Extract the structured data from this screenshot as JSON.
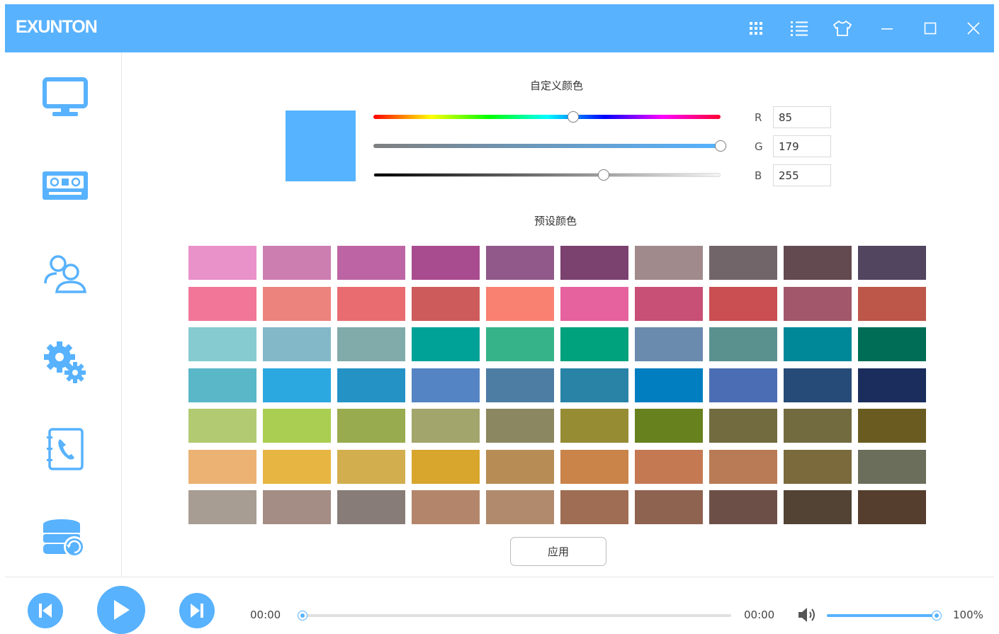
{
  "app": {
    "logo": "EXUNTON"
  },
  "titlebar": {
    "buttons": [
      {
        "name": "grid-icon"
      },
      {
        "name": "list-icon"
      },
      {
        "name": "skin-icon"
      },
      {
        "name": "minimize-icon"
      },
      {
        "name": "maximize-icon"
      },
      {
        "name": "close-icon"
      }
    ]
  },
  "sidebar": {
    "items": [
      {
        "name": "monitor-icon"
      },
      {
        "name": "cassette-icon"
      },
      {
        "name": "users-icon"
      },
      {
        "name": "gears-icon"
      },
      {
        "name": "phonebook-icon"
      },
      {
        "name": "database-sync-icon"
      }
    ]
  },
  "custom_color": {
    "title": "自定义颜色",
    "preview_color": "#55b3ff",
    "hue_fraction": 0.575,
    "saturation_fraction": 1.0,
    "brightness_fraction": 0.661,
    "r_label": "R",
    "r_value": "85",
    "g_label": "G",
    "g_value": "179",
    "b_label": "B",
    "b_value": "255"
  },
  "preset_color": {
    "title": "预设颜色",
    "swatches": [
      [
        "#e991c9",
        "#cc7eb1",
        "#bd65a4",
        "#a94c8f",
        "#915989",
        "#7b416f",
        "#a08a8c",
        "#726569",
        "#634a50",
        "#51455f"
      ],
      [
        "#f27698",
        "#ec837d",
        "#e96c70",
        "#ce5b5c",
        "#f98171",
        "#e6629f",
        "#c84f76",
        "#c94f52",
        "#a2576a",
        "#bc5749"
      ],
      [
        "#85cbd0",
        "#83b8c8",
        "#80abaa",
        "#00a298",
        "#37b38a",
        "#00a17d",
        "#6a8aae",
        "#5a918f",
        "#008899",
        "#006d57"
      ],
      [
        "#59b7c8",
        "#2ba8e0",
        "#2592c6",
        "#5584c4",
        "#4e7da4",
        "#2983a7",
        "#007ec0",
        "#4b6db3",
        "#274b79",
        "#1b2d5d"
      ],
      [
        "#b2ca71",
        "#aace52",
        "#98ab4e",
        "#a2a56c",
        "#8b8760",
        "#958c34",
        "#68811f",
        "#716b3f",
        "#726b40",
        "#6a5c21"
      ],
      [
        "#ebb273",
        "#e7b541",
        "#d2ae4e",
        "#d8a62d",
        "#b78d55",
        "#ca8349",
        "#c47953",
        "#b87b56",
        "#7a6a3c",
        "#6b6e5a"
      ],
      [
        "#a79d93",
        "#a48d84",
        "#877c77",
        "#b3866b",
        "#b18a6d",
        "#9f6d53",
        "#8e6350",
        "#6c5047",
        "#524334",
        "#553e2d"
      ]
    ]
  },
  "apply_button": {
    "label": "应用"
  },
  "player": {
    "time_current": "00:00",
    "time_total": "00:00",
    "progress_fraction": 0.0,
    "volume_label": "100%",
    "volume_fraction": 1.0
  },
  "colors": {
    "accent": "#58b2fe"
  }
}
